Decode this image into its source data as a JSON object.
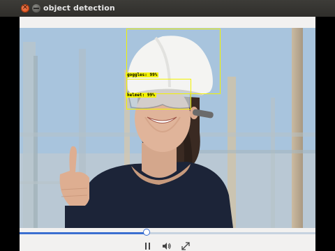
{
  "window": {
    "title": "object detection",
    "close_glyph": "×"
  },
  "detections": [
    {
      "label": "goggles: 99%",
      "color": "#f3f300"
    },
    {
      "label": "helmet: 99%",
      "color": "#f3f300"
    }
  ],
  "player": {
    "progress": 0.43,
    "accent_color": "#3b6fd0",
    "icons": [
      "pause-icon",
      "volume-icon",
      "fullscreen-icon"
    ]
  }
}
